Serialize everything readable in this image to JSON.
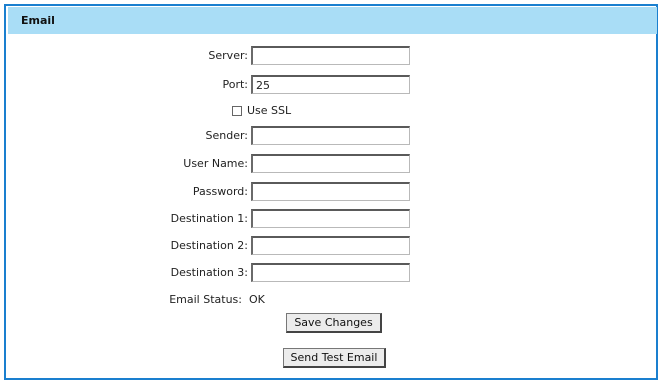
{
  "panel": {
    "title": "Email"
  },
  "form": {
    "server": {
      "label": "Server:",
      "value": ""
    },
    "port": {
      "label": "Port:",
      "value": "25"
    },
    "use_ssl": {
      "label": "Use SSL",
      "checked": false
    },
    "sender": {
      "label": "Sender:",
      "value": ""
    },
    "user_name": {
      "label": "User Name:",
      "value": ""
    },
    "password": {
      "label": "Password:",
      "value": ""
    },
    "destination1": {
      "label": "Destination 1:",
      "value": ""
    },
    "destination2": {
      "label": "Destination 2:",
      "value": ""
    },
    "destination3": {
      "label": "Destination 3:",
      "value": ""
    },
    "email_status": {
      "label": "Email Status:",
      "value": "OK"
    }
  },
  "buttons": {
    "save": "Save Changes",
    "send_test": "Send Test Email"
  },
  "colors": {
    "header_bg": "#a9ddf6",
    "border": "#1a7fcf"
  }
}
